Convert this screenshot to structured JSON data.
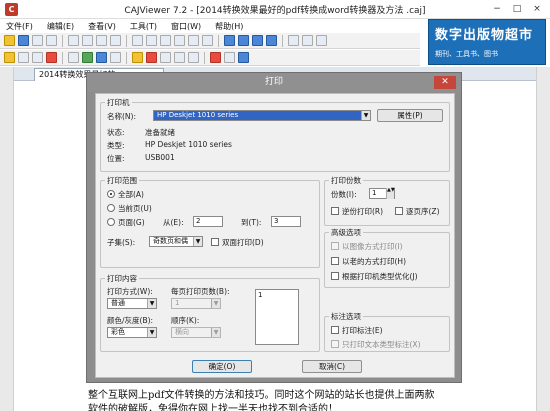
{
  "window": {
    "title": "CAJViewer 7.2 - [2014转换效果最好的pdf转换成word转换器及方法 .caj]",
    "icon": "caj-app-icon",
    "controls": [
      "−",
      "□",
      "×"
    ]
  },
  "menu": [
    "文件(F)",
    "编辑(E)",
    "查看(V)",
    "工具(T)",
    "窗口(W)",
    "帮助(H)"
  ],
  "ad": {
    "title": "数字出版物超市",
    "subtitle": "期刊、工具书、图书"
  },
  "doc_tab": "2014转换效果最好的...",
  "document_lines": [
    "整个互联网上pdf文件转换的方法和技巧。同时这个网站的站长也提供上面两款",
    "软件的破解版，免得你在网上找一半天也找不到合适的！"
  ],
  "dialog": {
    "title": "打印",
    "close": "✕",
    "printer": {
      "group": "打印机",
      "name_label": "名称(N):",
      "name_value": "HP Deskjet 1010 series",
      "properties_button": "属性(P)",
      "status_label": "状态:",
      "status_value": "准备就绪",
      "type_label": "类型:",
      "type_value": "HP Deskjet 1010 series",
      "location_label": "位置:",
      "location_value": "USB001"
    },
    "range": {
      "group": "打印范围",
      "all": "全部(A)",
      "current": "当前页(U)",
      "pages": "页面(G)",
      "from_label": "从(E):",
      "from_value": "2",
      "to_label": "到(T):",
      "to_value": "3",
      "subset_label": "子集(S):",
      "subset_value": "奇数页和偶",
      "duplex": "双面打印(D)"
    },
    "copies": {
      "group": "打印份数",
      "count_label": "份数(I):",
      "count_value": "1",
      "reverse": "逆份打印(R)",
      "collate": "逐页序(Z)"
    },
    "advanced": {
      "group": "高级选项",
      "image_mode": "以图像方式打印(I)",
      "old_mode": "以老的方式打印(H)",
      "optimize": "根据打印机类型优化(J)"
    },
    "content": {
      "group": "打印内容",
      "mode_label": "打印方式(W):",
      "mode_value": "普通",
      "pages_per_sheet_label": "每页打印页数(B):",
      "pages_per_sheet_value": "1",
      "color_label": "颜色/灰度(B):",
      "color_value": "彩色",
      "order_label": "顺序(K):",
      "order_value": "横向",
      "preview_value": "1"
    },
    "notes": {
      "group": "标注选项",
      "print_notes": "打印标注(E)",
      "text_notes": "只打印文本类型标注(X)"
    },
    "ok": "确定(O)",
    "cancel": "取消(C)"
  }
}
